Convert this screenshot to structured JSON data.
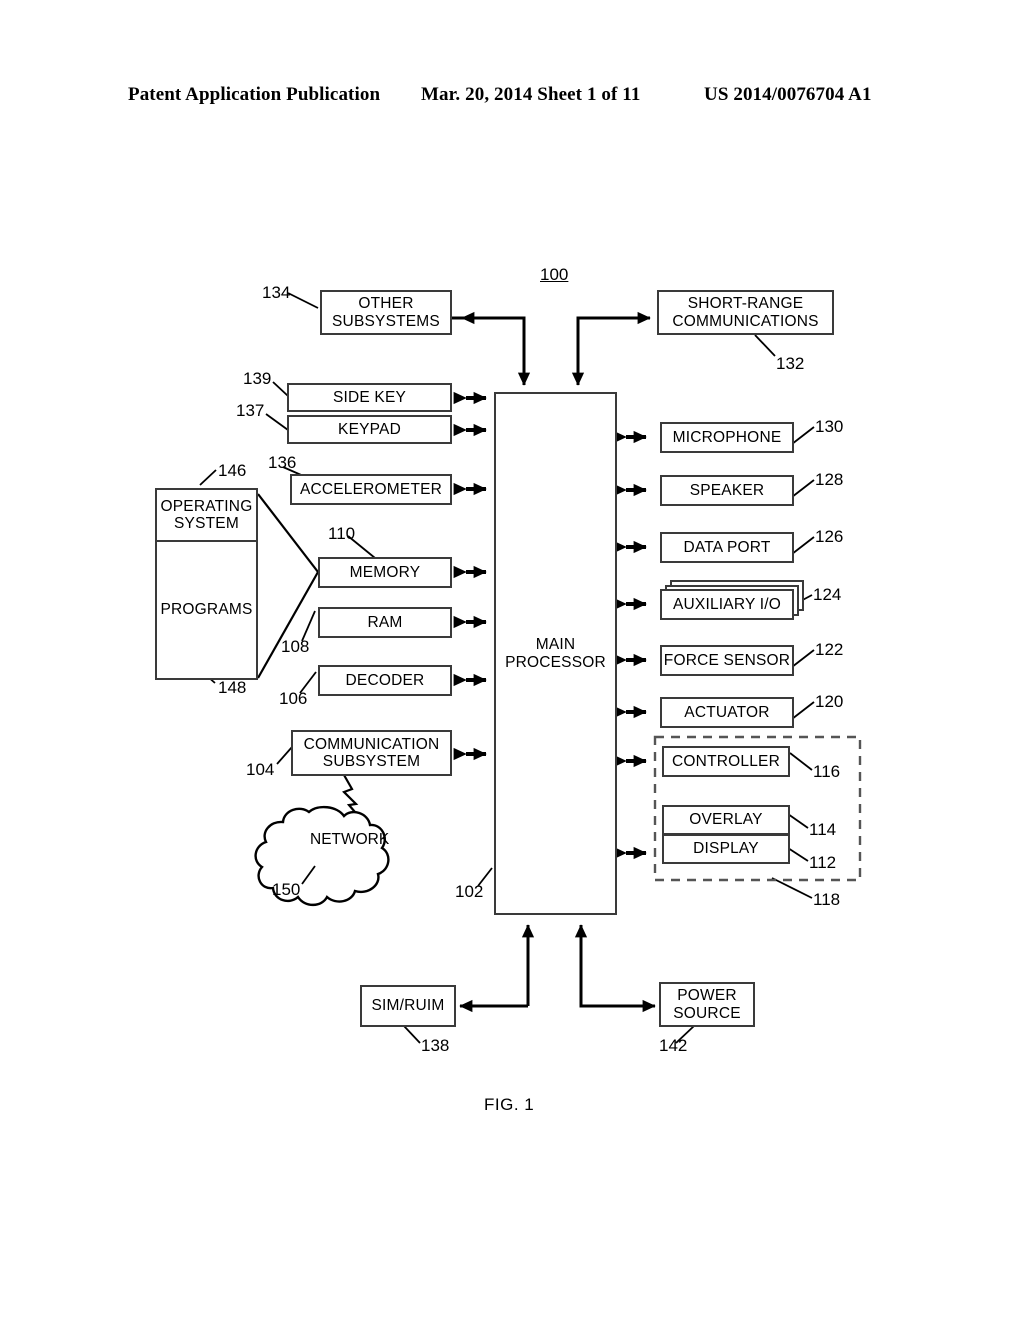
{
  "header": {
    "left": "Patent Application Publication",
    "middle": "Mar. 20, 2014  Sheet 1 of 11",
    "right": "US 2014/0076704 A1"
  },
  "figure": {
    "caption": "FIG. 1",
    "system_number": "100",
    "stroke_color": "#3a3a3a",
    "line_color": "#000000"
  },
  "blocks": {
    "other_subsystems": {
      "label_line1": "OTHER",
      "label_line2": "SUBSYSTEMS",
      "ref": "134"
    },
    "short_range": {
      "label_line1": "SHORT-RANGE",
      "label_line2": "COMMUNICATIONS",
      "ref": "132"
    },
    "side_key": {
      "label": "SIDE KEY",
      "ref": "139"
    },
    "keypad": {
      "label": "KEYPAD",
      "ref": "137"
    },
    "accelerometer": {
      "label": "ACCELEROMETER",
      "ref": "136"
    },
    "memory": {
      "label": "MEMORY",
      "ref": "110"
    },
    "ram": {
      "label": "RAM",
      "ref": "108"
    },
    "decoder": {
      "label": "DECODER",
      "ref": "106"
    },
    "communication_subsystem": {
      "label_line1": "COMMUNICATION",
      "label_line2": "SUBSYSTEM",
      "ref": "104"
    },
    "network": {
      "label": "NETWORK",
      "ref": "150"
    },
    "operating_system": {
      "label_line1": "OPERATING",
      "label_line2": "SYSTEM",
      "ref": "146"
    },
    "programs": {
      "label": "PROGRAMS",
      "ref": "148"
    },
    "main_processor": {
      "label_line1": "MAIN",
      "label_line2": "PROCESSOR",
      "ref": "102"
    },
    "microphone": {
      "label": "MICROPHONE",
      "ref": "130"
    },
    "speaker": {
      "label": "SPEAKER",
      "ref": "128"
    },
    "data_port": {
      "label": "DATA PORT",
      "ref": "126"
    },
    "auxiliary_io": {
      "label": "AUXILIARY I/O",
      "ref": "124"
    },
    "force_sensor": {
      "label": "FORCE SENSOR",
      "ref": "122"
    },
    "actuator": {
      "label": "ACTUATOR",
      "ref": "120"
    },
    "controller": {
      "label": "CONTROLLER",
      "ref": "116"
    },
    "overlay": {
      "label": "OVERLAY",
      "ref": "114"
    },
    "display": {
      "label": "DISPLAY",
      "ref": "112"
    },
    "touchscreen_group": {
      "ref": "118"
    },
    "sim_ruim": {
      "label": "SIM/RUIM",
      "ref": "138"
    },
    "power_source": {
      "label_line1": "POWER",
      "label_line2": "SOURCE",
      "ref": "142"
    }
  }
}
